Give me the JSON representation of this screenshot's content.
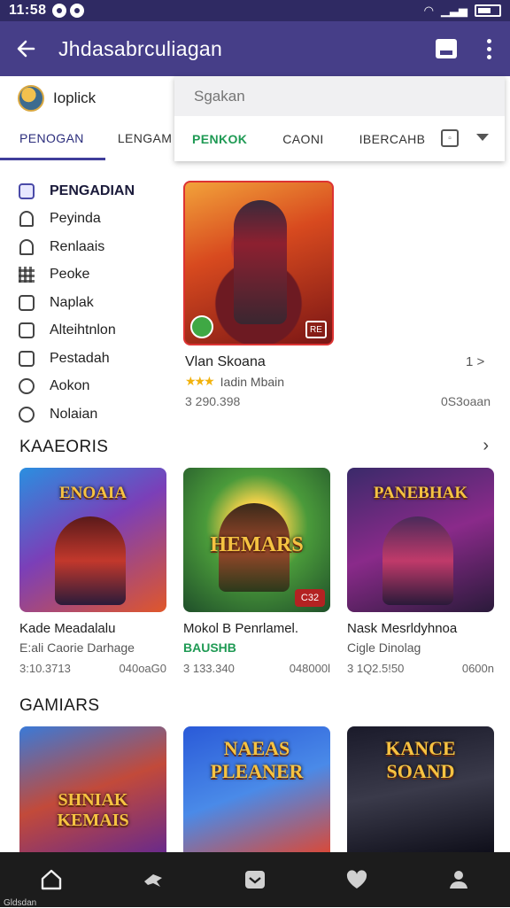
{
  "status": {
    "time": "11:58"
  },
  "appbar": {
    "title": "Jhdasabrculiagan"
  },
  "profile": {
    "name": "Ioplick"
  },
  "tabs": [
    "PENOGAN",
    "LENGAM"
  ],
  "search": {
    "placeholder": "Sgakan"
  },
  "filters": [
    "PENKOK",
    "CAONI",
    "IBERCAHB"
  ],
  "side_menu": [
    {
      "label": "PENGADIAN",
      "icon": "library-icon",
      "active": true
    },
    {
      "label": "Peyinda",
      "icon": "person-icon"
    },
    {
      "label": "Renlaais",
      "icon": "bell-icon"
    },
    {
      "label": "Peoke",
      "icon": "grid-icon"
    },
    {
      "label": "Naplak",
      "icon": "minus-box-icon"
    },
    {
      "label": "Alteihtnlon",
      "icon": "lock-icon"
    },
    {
      "label": "Pestadah",
      "icon": "clipboard-icon"
    },
    {
      "label": "Aokon",
      "icon": "clock-icon"
    },
    {
      "label": "Nolaian",
      "icon": "timer-icon"
    }
  ],
  "featured": {
    "title": "Vlan Skoana",
    "nav": "1 >",
    "rating_text": "Iadin Mbain",
    "stars": "★★★",
    "meta": "3 290.398",
    "size": "0S3oaan",
    "badge": "RE"
  },
  "section1": {
    "title": "KAAEORIS",
    "arrow": "›",
    "cards": [
      {
        "name": "Kade Meadalalu",
        "sub": "E:ali  Caorie Darhage",
        "sub_green": false,
        "meta_left": "3:10.3713",
        "meta_right": "040oaG0",
        "banner": "ENOAIA",
        "chip": ""
      },
      {
        "name": "Mokol B Penrlamel.",
        "sub": "BAUSHB",
        "sub_green": true,
        "meta_left": "3 133.340",
        "meta_right": "048000l",
        "banner": "HEMARS",
        "chip": "C32"
      },
      {
        "name": "Nask Mesrldyhnoa",
        "sub": "Cigle Dinolag",
        "sub_green": false,
        "meta_left": "3 1Q2.5!50",
        "meta_right": "0600n",
        "banner": "PANEBHAK",
        "chip": ""
      }
    ]
  },
  "section2": {
    "title": "GAMIARS",
    "cards": [
      {
        "banner": "SHNIAK KEMAIS"
      },
      {
        "banner": "NAEAS PLEANER"
      },
      {
        "banner": "KANCE SOAND"
      }
    ]
  },
  "bottom_nav": {
    "home_label": "Gldsdan"
  },
  "colors": {
    "app_bar": "#463e88",
    "status_bar": "#2f2a63",
    "accent_green": "#1f9a54",
    "accent_tab": "#3f3d9a",
    "bottom_nav": "#1c1c1c"
  }
}
